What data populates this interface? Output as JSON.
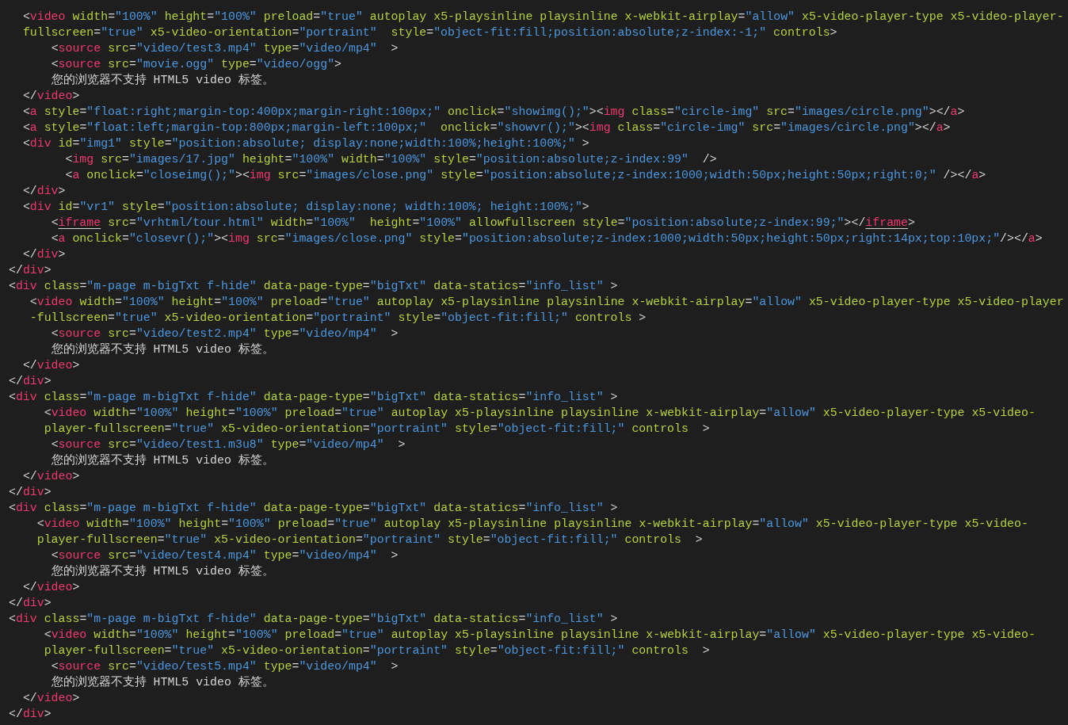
{
  "editor": {
    "lines": [
      {
        "text": "  <video width=\"100%\" height=\"100%\" preload=\"true\" autoplay x5-playsinline playsinline x-webkit-airplay=\"allow\" x5-video-player-type x5-video-player-"
      },
      {
        "text": "  fullscreen=\"true\" x5-video-orientation=\"portraint\"  style=\"object-fit:fill;position:absolute;z-index:-1;\" controls>"
      },
      {
        "text": "      <source src=\"video/test3.mp4\" type=\"video/mp4\"  >"
      },
      {
        "text": "      <source src=\"movie.ogg\" type=\"video/ogg\">"
      },
      {
        "text": "      您的浏览器不支持 HTML5 video 标签。"
      },
      {
        "text": "  </video>"
      },
      {
        "text": "  <a style=\"float:right;margin-top:400px;margin-right:100px;\" onclick=\"showimg();\"><img class=\"circle-img\" src=\"images/circle.png\"></a>"
      },
      {
        "text": "  <a style=\"float:left;margin-top:800px;margin-left:100px;\"  onclick=\"showvr();\"><img class=\"circle-img\" src=\"images/circle.png\"></a>"
      },
      {
        "text": "  <div id=\"img1\" style=\"position:absolute; display:none;width:100%;height:100%;\" >"
      },
      {
        "text": "        <img src=\"images/17.jpg\" height=\"100%\" width=\"100%\" style=\"position:absolute;z-index:99\"  />"
      },
      {
        "text": "        <a onclick=\"closeimg();\"><img src=\"images/close.png\" style=\"position:absolute;z-index:1000;width:50px;height:50px;right:0;\" /></a>"
      },
      {
        "text": "  </div>"
      },
      {
        "text": "  <div id=\"vr1\" style=\"position:absolute; display:none; width:100%; height:100%;\">"
      },
      {
        "text": "      <iframe src=\"vrhtml/tour.html\" width=\"100%\"  height=\"100%\" allowfullscreen style=\"position:absolute;z-index:99;\"></iframe>",
        "flagged": true
      },
      {
        "text": "      <a onclick=\"closevr();\"><img src=\"images/close.png\" style=\"position:absolute;z-index:1000;width:50px;height:50px;right:14px;top:10px;\"/></a>"
      },
      {
        "text": "  </div>"
      },
      {
        "text": "</div>"
      },
      {
        "text": "<div class=\"m-page m-bigTxt f-hide\" data-page-type=\"bigTxt\" data-statics=\"info_list\" >"
      },
      {
        "text": "   <video width=\"100%\" height=\"100%\" preload=\"true\" autoplay x5-playsinline playsinline x-webkit-airplay=\"allow\" x5-video-player-type x5-video-player"
      },
      {
        "text": "   -fullscreen=\"true\" x5-video-orientation=\"portraint\" style=\"object-fit:fill;\" controls >"
      },
      {
        "text": "      <source src=\"video/test2.mp4\" type=\"video/mp4\"  >"
      },
      {
        "text": "      您的浏览器不支持 HTML5 video 标签。"
      },
      {
        "text": "  </video>"
      },
      {
        "text": "</div>"
      },
      {
        "text": "<div class=\"m-page m-bigTxt f-hide\" data-page-type=\"bigTxt\" data-statics=\"info_list\" >"
      },
      {
        "text": "     <video width=\"100%\" height=\"100%\" preload=\"true\" autoplay x5-playsinline playsinline x-webkit-airplay=\"allow\" x5-video-player-type x5-video-"
      },
      {
        "text": "     player-fullscreen=\"true\" x5-video-orientation=\"portraint\" style=\"object-fit:fill;\" controls  >"
      },
      {
        "text": "      <source src=\"video/test1.m3u8\" type=\"video/mp4\"  >"
      },
      {
        "text": "      您的浏览器不支持 HTML5 video 标签。"
      },
      {
        "text": "  </video>"
      },
      {
        "text": "</div>"
      },
      {
        "text": "<div class=\"m-page m-bigTxt f-hide\" data-page-type=\"bigTxt\" data-statics=\"info_list\" >"
      },
      {
        "text": "    <video width=\"100%\" height=\"100%\" preload=\"true\" autoplay x5-playsinline playsinline x-webkit-airplay=\"allow\" x5-video-player-type x5-video-"
      },
      {
        "text": "    player-fullscreen=\"true\" x5-video-orientation=\"portraint\" style=\"object-fit:fill;\" controls  >"
      },
      {
        "text": "      <source src=\"video/test4.mp4\" type=\"video/mp4\"  >"
      },
      {
        "text": "      您的浏览器不支持 HTML5 video 标签。"
      },
      {
        "text": "  </video>"
      },
      {
        "text": "</div>"
      },
      {
        "text": "<div class=\"m-page m-bigTxt f-hide\" data-page-type=\"bigTxt\" data-statics=\"info_list\" >"
      },
      {
        "text": "     <video width=\"100%\" height=\"100%\" preload=\"true\" autoplay x5-playsinline playsinline x-webkit-airplay=\"allow\" x5-video-player-type x5-video-"
      },
      {
        "text": "     player-fullscreen=\"true\" x5-video-orientation=\"portraint\" style=\"object-fit:fill;\" controls  >"
      },
      {
        "text": "      <source src=\"video/test5.mp4\" type=\"video/mp4\"  >"
      },
      {
        "text": "      您的浏览器不支持 HTML5 video 标签。"
      },
      {
        "text": "  </video>"
      },
      {
        "text": "</div>"
      }
    ]
  }
}
